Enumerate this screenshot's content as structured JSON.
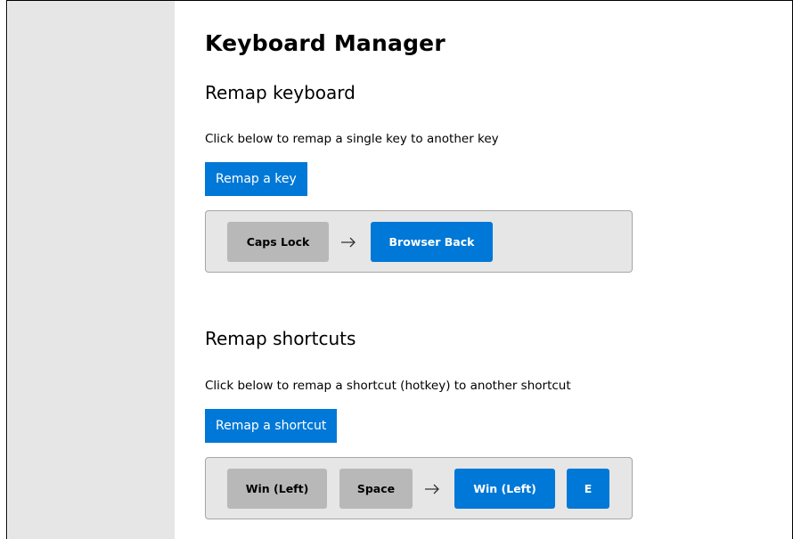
{
  "page": {
    "title": "Keyboard Manager"
  },
  "remap_keyboard": {
    "heading": "Remap keyboard",
    "description": "Click below to remap a single key to another key",
    "button_label": "Remap a key",
    "mappings": [
      {
        "original": [
          "Caps Lock"
        ],
        "new": [
          "Browser Back"
        ]
      }
    ]
  },
  "remap_shortcuts": {
    "heading": "Remap shortcuts",
    "description": "Click below to remap a shortcut (hotkey) to another shortcut",
    "button_label": "Remap a shortcut",
    "mappings": [
      {
        "original": [
          "Win (Left)",
          "Space"
        ],
        "new": [
          "Win (Left)",
          "E"
        ]
      }
    ]
  },
  "colors": {
    "accent": "#0078d7",
    "nav_background": "#e6e6e6",
    "original_key": "#b8b8b8",
    "card_background": "#e6e6e6"
  },
  "icons": {
    "mapping_arrow": "right-arrow-icon"
  }
}
